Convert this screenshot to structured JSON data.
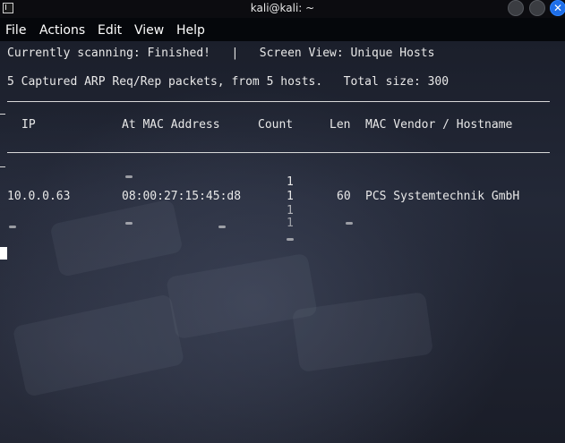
{
  "window": {
    "title": "kali@kali: ~",
    "close_glyph": "✕",
    "colors": {
      "accent": "#1e6ee8",
      "text": "#e8e8e8"
    }
  },
  "menubar": {
    "items": [
      {
        "label": "File"
      },
      {
        "label": "Actions"
      },
      {
        "label": "Edit"
      },
      {
        "label": "View"
      },
      {
        "label": "Help"
      }
    ]
  },
  "terminal": {
    "status_line": "Currently scanning: Finished!   |   Screen View: Unique Hosts",
    "summary_line": "5 Captured ARP Req/Rep packets, from 5 hosts.   Total size: 300",
    "columns": [
      "IP",
      "At MAC Address",
      "Count",
      "Len",
      "MAC Vendor / Hostname"
    ],
    "rows": [
      {
        "ip": "10.0.0.63",
        "mac": "08:00:27:15:45:d8",
        "count": "1",
        "len": "60",
        "vendor": "PCS Systemtechnik GmbH"
      }
    ],
    "count_stack": [
      "1",
      "1",
      "1"
    ]
  }
}
